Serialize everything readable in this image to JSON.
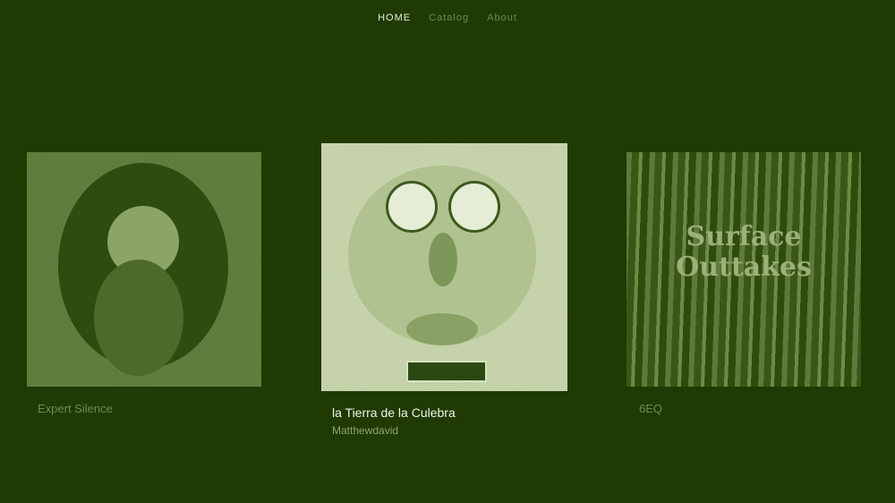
{
  "nav": {
    "items": [
      {
        "label": "HOME"
      },
      {
        "label": "Catalog"
      },
      {
        "label": "About"
      }
    ]
  },
  "albums": [
    {
      "title": "Expert Silence",
      "artist": ""
    },
    {
      "title": "la Tierra de la Culebra",
      "artist": "Matthewdavid"
    },
    {
      "title": "6EQ",
      "artist": "",
      "cover_text": "Surface Outtakes"
    }
  ],
  "colors": {
    "background": "#1f3a03",
    "accent_text": "#f0f3e4",
    "muted_text": "#6f8a4e"
  }
}
